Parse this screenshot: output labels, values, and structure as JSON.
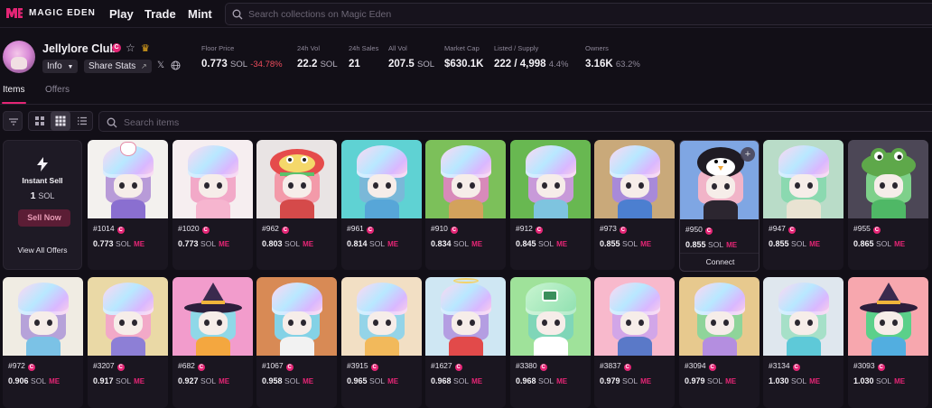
{
  "nav": {
    "logo_text": "MAGIC EDEN",
    "links": [
      "Play",
      "Trade",
      "Mint"
    ],
    "search_placeholder": "Search collections on Magic Eden"
  },
  "collection": {
    "name": "Jellylore Club",
    "info_label": "Info",
    "share_label": "Share Stats",
    "stats": [
      {
        "label": "Floor Price",
        "value": "0.773",
        "unit": "SOL",
        "change": "-34.78%"
      },
      {
        "label": "24h Vol",
        "value": "22.2",
        "unit": "SOL"
      },
      {
        "label": "24h Sales",
        "value": "21"
      },
      {
        "label": "All Vol",
        "value": "207.5",
        "unit": "SOL"
      },
      {
        "label": "Market Cap",
        "value": "$630.1K"
      },
      {
        "label": "Listed / Supply",
        "value": "222 / 4,998",
        "pct": "4.4%"
      },
      {
        "label": "Owners",
        "value": "3.16K",
        "pct": "63.2%"
      }
    ]
  },
  "tabs": [
    "Items",
    "Offers"
  ],
  "items_search_placeholder": "Search items",
  "instant_sell": {
    "title": "Instant Sell",
    "amount": "1",
    "unit": "SOL",
    "button": "Sell Now",
    "view_all": "View All Offers"
  },
  "price_unit": "SOL",
  "me_badge": "ME",
  "verified_badge": "C",
  "connect_label": "Connect",
  "cards": [
    {
      "name": "#1014",
      "price": "0.773",
      "bg": "#f3f1ee",
      "hair": "#b89bd8",
      "body": "#8a6fd0",
      "head": "mask"
    },
    {
      "name": "#1020",
      "price": "0.773",
      "bg": "#f6eef0",
      "hair": "#f2a9c8",
      "body": "#f6b5cf",
      "head": "jelly"
    },
    {
      "name": "#962",
      "price": "0.803",
      "bg": "#e9e4e4",
      "hair": "#f39aa9",
      "body": "#d54a4a",
      "head": "lion"
    },
    {
      "name": "#961",
      "price": "0.814",
      "bg": "#5fd2d3",
      "hair": "#7ab8d8",
      "body": "#57a6d8",
      "head": "jelly"
    },
    {
      "name": "#910",
      "price": "0.834",
      "bg": "#7cc05a",
      "hair": "#d88ab9",
      "body": "#d3a25c",
      "head": "jelly"
    },
    {
      "name": "#912",
      "price": "0.845",
      "bg": "#68b851",
      "hair": "#c89ad9",
      "body": "#7ec4df",
      "head": "jelly"
    },
    {
      "name": "#973",
      "price": "0.855",
      "bg": "#c9a97a",
      "hair": "#a88ad9",
      "body": "#4c7fd0",
      "head": "jelly"
    },
    {
      "name": "#950",
      "price": "0.855",
      "bg": "#7fa6e3",
      "hair": "#f1b4c8",
      "body": "#2c2630",
      "head": "penguin",
      "connect": true
    },
    {
      "name": "#947",
      "price": "0.855",
      "bg": "#b9dcc8",
      "hair": "#8bd9b0",
      "body": "#e9e3d2",
      "head": "jelly"
    },
    {
      "name": "#955",
      "price": "0.865",
      "bg": "#4c4756",
      "hair": "#7ed08a",
      "body": "#4fb866",
      "head": "pepe"
    },
    {
      "name": "#972",
      "price": "0.906",
      "bg": "#f0ece3",
      "hair": "#b6a2d9",
      "body": "#7bc2e6",
      "head": "jelly"
    },
    {
      "name": "#3207",
      "price": "0.917",
      "bg": "#ead9a6",
      "hair": "#f2a9c8",
      "body": "#8d7fd6",
      "head": "jelly"
    },
    {
      "name": "#682",
      "price": "0.927",
      "bg": "#f29ccc",
      "hair": "#8fd8e8",
      "body": "#f4a73f",
      "head": "witch"
    },
    {
      "name": "#1067",
      "price": "0.958",
      "bg": "#d88a55",
      "hair": "#84d2e6",
      "body": "#f2f2f2",
      "head": "jelly"
    },
    {
      "name": "#3915",
      "price": "0.965",
      "bg": "#f2dfc4",
      "hair": "#94d4e8",
      "body": "#f2b95b",
      "head": "jelly"
    },
    {
      "name": "#1627",
      "price": "0.968",
      "bg": "#cfe7f3",
      "hair": "#b49ee2",
      "body": "#e24a4a",
      "head": "angel"
    },
    {
      "name": "#3380",
      "price": "0.968",
      "bg": "#9fe29a",
      "hair": "#7fd6b8",
      "body": "#ffffff",
      "head": "tv"
    },
    {
      "name": "#3837",
      "price": "0.979",
      "bg": "#f8b9cc",
      "hair": "#d2a6e8",
      "body": "#5a79c8",
      "head": "jelly"
    },
    {
      "name": "#3094",
      "price": "0.979",
      "bg": "#e7c98e",
      "hair": "#8fd49a",
      "body": "#b48ee0",
      "head": "jelly"
    },
    {
      "name": "#3134",
      "price": "1.030",
      "bg": "#dfe7ee",
      "hair": "#a6e0c8",
      "body": "#5ec9d8",
      "head": "jelly"
    },
    {
      "name": "#3093",
      "price": "1.030",
      "bg": "#f7a7ae",
      "hair": "#5bd08a",
      "body": "#52aee0",
      "head": "witch"
    }
  ]
}
